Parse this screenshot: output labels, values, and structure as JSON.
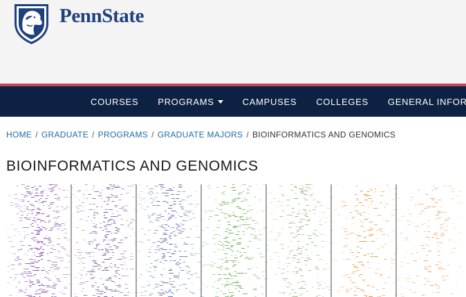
{
  "header": {
    "brand": "PennState",
    "logo_icon": "nittany-lion-shield-icon",
    "brand_color": "#1e407c"
  },
  "nav": {
    "items": [
      {
        "label": "COURSES",
        "has_dropdown": false
      },
      {
        "label": "PROGRAMS",
        "has_dropdown": true
      },
      {
        "label": "CAMPUSES",
        "has_dropdown": false
      },
      {
        "label": "COLLEGES",
        "has_dropdown": false
      },
      {
        "label": "GENERAL INFORMATION",
        "has_dropdown": false
      }
    ],
    "background": "#0d2143",
    "accent": "#c4465e"
  },
  "breadcrumb": {
    "items": [
      {
        "label": "HOME",
        "link": true
      },
      {
        "label": "GRADUATE",
        "link": true
      },
      {
        "label": "PROGRAMS",
        "link": true
      },
      {
        "label": "GRADUATE MAJORS",
        "link": true
      },
      {
        "label": "BIOINFORMATICS AND GENOMICS",
        "link": false
      }
    ],
    "separator": "/"
  },
  "page": {
    "title": "BIOINFORMATICS AND GENOMICS"
  },
  "hero_image": {
    "description_icon": "genomic-heatmap-banner",
    "panel_colors": [
      "#7b3fa0",
      "#6a4a9a",
      "#5560b0",
      "#5aa83c",
      "#8ab070",
      "#f08a2c",
      "#f0a060"
    ]
  }
}
